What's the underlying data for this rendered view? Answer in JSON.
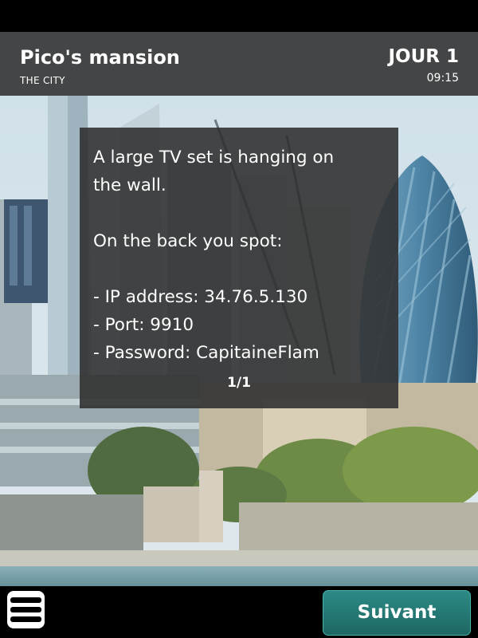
{
  "header": {
    "location_name": "Pico's mansion",
    "location_sub": "THE CITY",
    "day": "JOUR 1",
    "time": "09:15"
  },
  "dialog": {
    "lines": [
      "A large TV set is hanging on",
      "the wall.",
      "",
      "On the back you spot:",
      "",
      "- IP address: 34.76.5.130",
      "- Port: 9910",
      "- Password: CapitaineFlam"
    ],
    "pager": "1/1"
  },
  "footer": {
    "menu_icon": "hamburger-menu-icon",
    "next_label": "Suivant"
  },
  "colors": {
    "header_bg": "#373737",
    "dialog_bg": "#2d2d2d",
    "button_teal": "#2c8a85"
  }
}
